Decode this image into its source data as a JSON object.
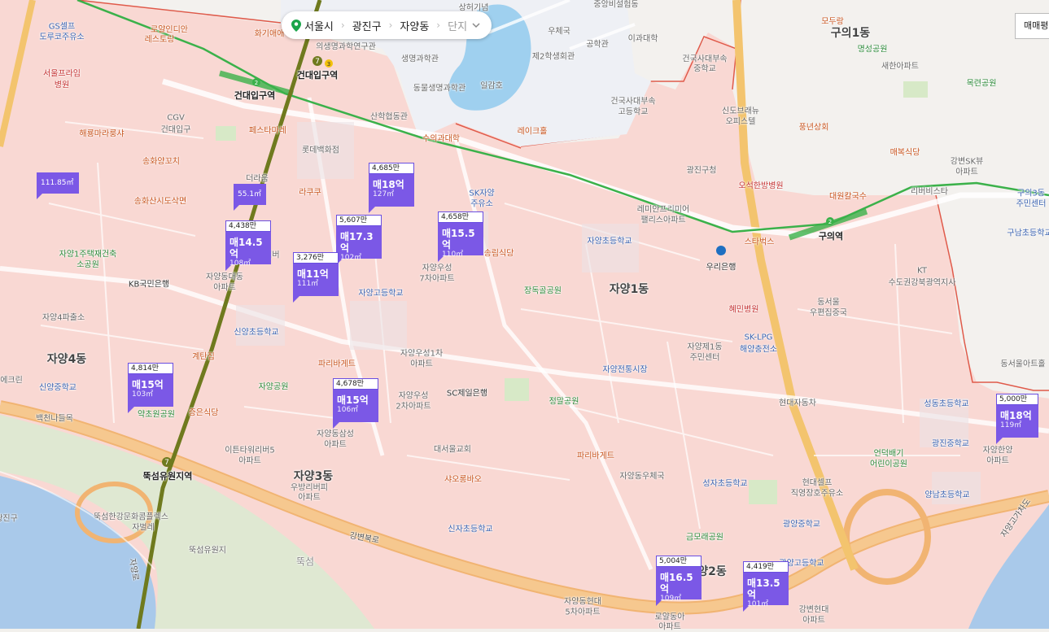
{
  "breadcrumb": {
    "city": "서울시",
    "district": "광진구",
    "dong": "자양동",
    "complex": "단지"
  },
  "toggle": {
    "label": "매매평당"
  },
  "markers": [
    {
      "unit_price": "4,438만",
      "price": "매14.5억",
      "area": "108㎡"
    },
    {
      "unit_price": "4,685만",
      "price": "매18억",
      "area": "127㎡"
    },
    {
      "unit_price": "5,607만",
      "price": "매17.3억",
      "area": "102㎡"
    },
    {
      "unit_price": "4,658만",
      "price": "매15.5억",
      "area": "110㎡"
    },
    {
      "unit_price": "3,276만",
      "price": "매11억",
      "area": "111㎡"
    },
    {
      "unit_price": "4,814만",
      "price": "매15억",
      "area": "103㎡"
    },
    {
      "unit_price": "4,678만",
      "price": "매15억",
      "area": "106㎡"
    },
    {
      "unit_price": "5,000만",
      "price": "매18억",
      "area": "119㎡"
    },
    {
      "unit_price": "5,004만",
      "price": "매16.5억",
      "area": "109㎡"
    },
    {
      "unit_price": "4,419만",
      "price": "매13.5억",
      "area": "101㎡"
    }
  ],
  "mini_markers": [
    {
      "area": "111.85㎡"
    },
    {
      "area": "55.1㎡"
    }
  ],
  "areas": {
    "jayang1": "자양1동",
    "jayang2": "양2동",
    "jayang3": "자양3동",
    "jayang4": "자양4동",
    "guui1": "구의1동",
    "ttukseom": "뚝섬"
  },
  "stations": {
    "konkuk_top": "건대입구역",
    "konkuk": "건대입구역",
    "guui": "구의역",
    "ttukseom_resort": "뚝섬유원지역"
  },
  "roads": {
    "gangbyeon": "강변북로",
    "jayanggogaro": "자양고가차도",
    "jayangro": "자양로"
  },
  "pois": [
    "상허기념",
    "중앙비설험동",
    "GS셀프",
    "도루코주유소",
    "로얄인디안",
    "레스토랑",
    "화기애애",
    "의생명과학연구관",
    "생명과학관",
    "동물생명과학관",
    "우체국",
    "공학관",
    "이과대학",
    "제2학생회관",
    "일감호",
    "모두랑",
    "명성공원",
    "새한아파트",
    "목련공원",
    "서울프라임",
    "병원",
    "CGV",
    "건대입구",
    "페스타마레",
    "산학협동관",
    "수의과대학",
    "레이크홀",
    "건국사대부속",
    "중학교",
    "건국사대부속",
    "고등학교",
    "신도브래뉴",
    "오피스텔",
    "풍년상회",
    "해룡마라룽샤",
    "롯데백화점",
    "송화양꼬치",
    "라쿠쿠",
    "더라움",
    "송화산시도삭면",
    "광진구청",
    "매복식당",
    "강변SK뷰",
    "아파트",
    "오석한방병원",
    "레미안프리미어",
    "팰리스아파트",
    "대원칼국수",
    "리버비스타",
    "구의3동",
    "주민센터",
    "구남초등학교",
    "SK자양",
    "주유소",
    "자양1주택재건축",
    "소공원",
    "송림식당",
    "자양초등학교",
    "스타벅스",
    "KT",
    "수도권강북광역지사",
    "KB국민은행",
    "자양동대동",
    "아파트",
    "장독골공원",
    "자양우성",
    "7차아파트",
    "우리은행",
    "자양고등학교",
    "동서울",
    "우편집중국",
    "혜민병원",
    "자양4파출소",
    "신양초등학교",
    "자양제1동",
    "주민센터",
    "SK-LPG",
    "해양충전소",
    "계탄집",
    "파리바게트",
    "자양우성1차",
    "아파트",
    "자양전통시장",
    "동서울아트홀",
    "에크린",
    "신양중학교",
    "자양공원",
    "자양우성",
    "2차아파트",
    "SC제일은행",
    "현대자동차",
    "성동초등학교",
    "정말공원",
    "약초원공원",
    "증은식당",
    "백천나들목",
    "자양동삼성",
    "아파트",
    "대서울교회",
    "광진중학교",
    "파리바게트",
    "언덕배기",
    "어린이공원",
    "자양한양",
    "아파트",
    "이튼타워리버5",
    "아파트",
    "우방리버피",
    "아파트",
    "자양동우체국",
    "샤오롱바오",
    "성자초등학교",
    "현대셀프",
    "직영장호주유소",
    "양남초등학교",
    "뚝섬한강문화콤플렉스",
    "자벌레",
    "신자초등학교",
    "금모래공원",
    "광양중학교",
    "광양고등학교",
    "뚝섬유원지",
    "자양동현대",
    "5차아파트",
    "로얄동아",
    "아파트",
    "강변현대",
    "아파트",
    "이튼타워리버",
    "광진구"
  ]
}
